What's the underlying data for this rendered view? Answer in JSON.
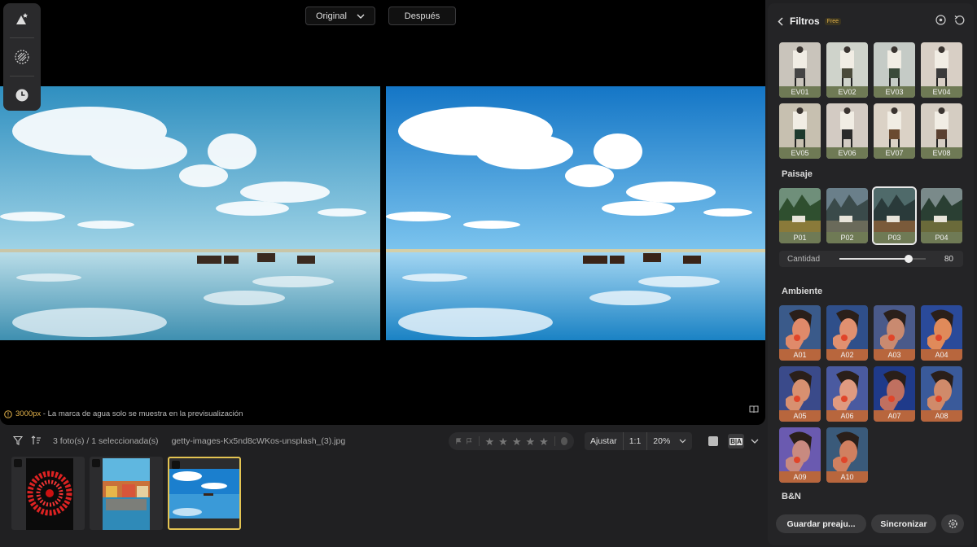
{
  "compare": {
    "original_label": "Original",
    "after_label": "Después"
  },
  "toolbox": {
    "items": [
      {
        "icon": "shapes-icon"
      },
      {
        "icon": "texture-icon"
      },
      {
        "icon": "history-icon"
      }
    ]
  },
  "viewer": {
    "px_value": "3000px",
    "watermark_text": " - La marca de agua solo se muestra en la previsualización"
  },
  "bottombar": {
    "count_text": "3 foto(s) / 1 seleccionada(s)",
    "file_name": "getty-images-Kx5nd8cWKos-unsplash_(3).jpg",
    "stars": [
      "★",
      "★",
      "★",
      "★",
      "★"
    ],
    "fit_label": "Ajustar",
    "ratio_label": "1:1",
    "zoom_value": "20%",
    "ba_label": "B|A"
  },
  "panel": {
    "title": "Filtros",
    "badge": "Free",
    "ev": [
      "EV01",
      "EV02",
      "EV03",
      "EV04",
      "EV05",
      "EV06",
      "EV07",
      "EV08"
    ],
    "paisaje_title": "Paisaje",
    "paisaje": [
      "P01",
      "P02",
      "P03",
      "P04"
    ],
    "amount_label": "Cantidad",
    "amount_value": "80",
    "amount_fraction": 0.8,
    "ambiente_title": "Ambiente",
    "ambiente": [
      "A01",
      "A02",
      "A03",
      "A04",
      "A05",
      "A06",
      "A07",
      "A08",
      "A09",
      "A10"
    ],
    "bn_title": "B&N",
    "save_label": "Guardar preaju...",
    "sync_label": "Sincronizar"
  },
  "colors": {
    "accent": "#e3c352",
    "panel_bg": "#242426",
    "ev_label": "#6f7a55",
    "p_label": "#6f7a55",
    "a_label": "#b8663d"
  }
}
